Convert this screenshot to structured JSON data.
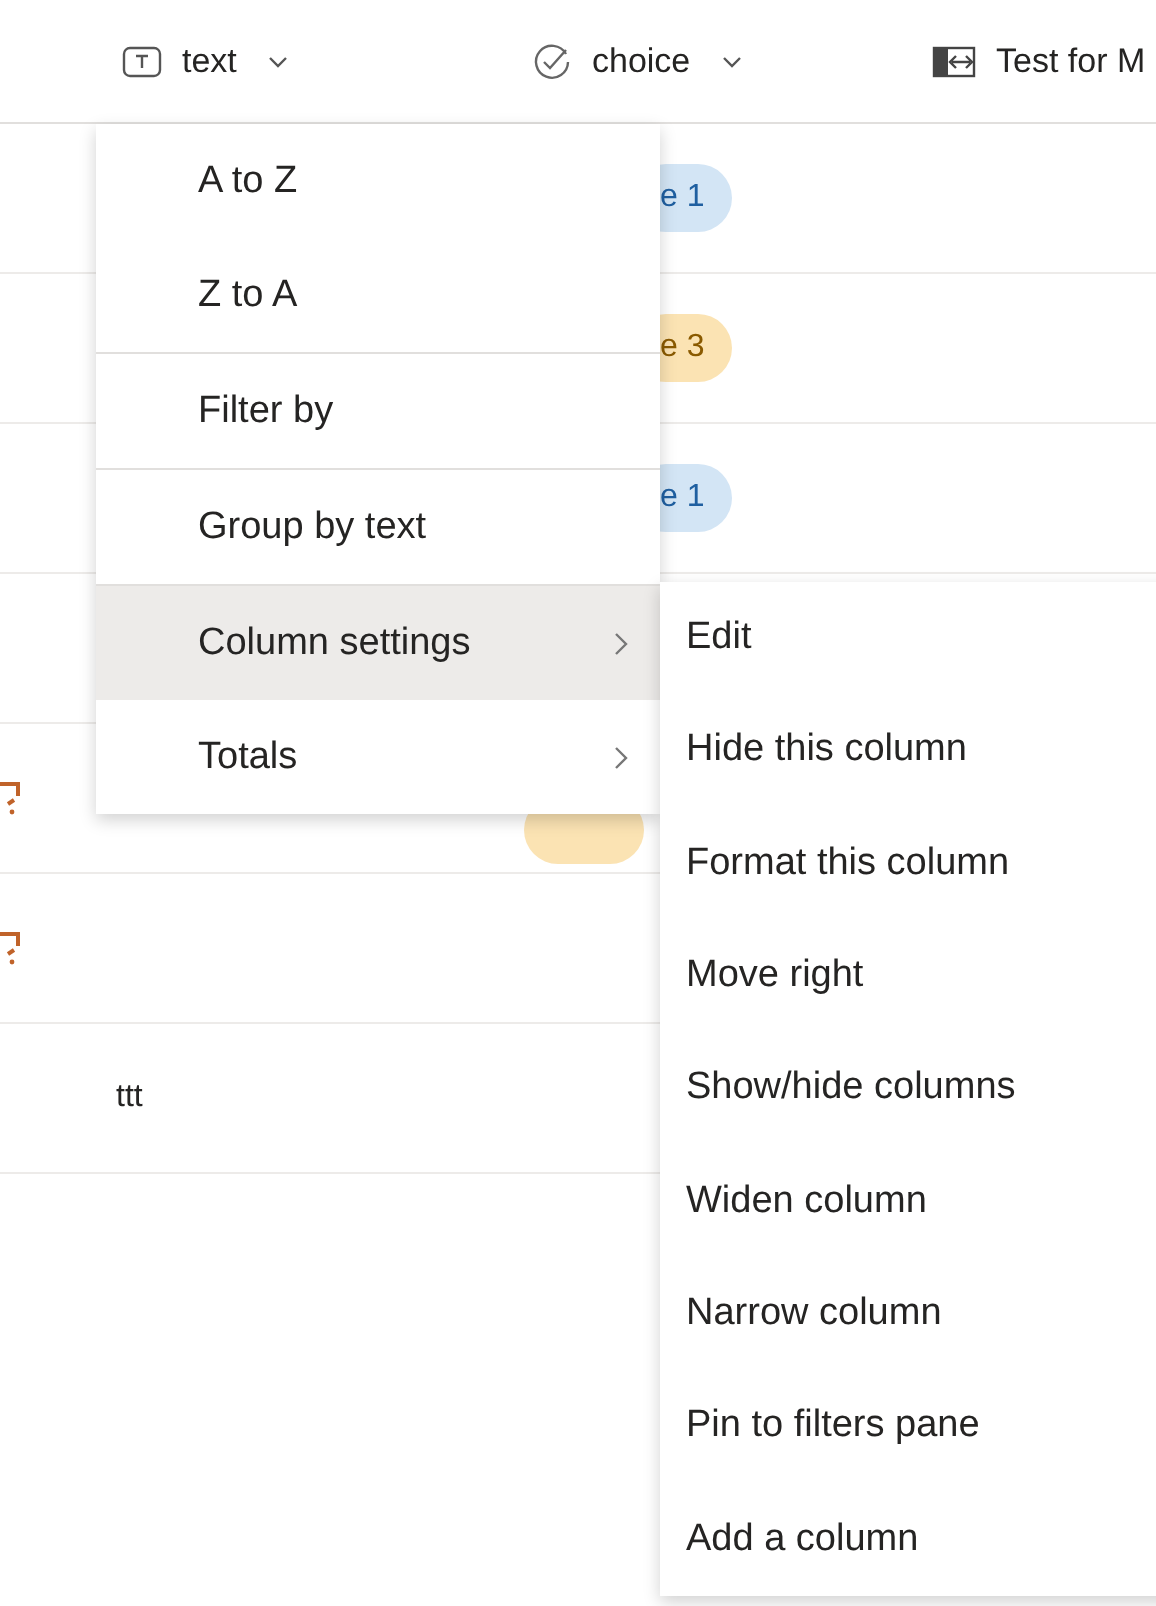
{
  "columns": [
    {
      "label": "text",
      "kind": "text",
      "caret": true
    },
    {
      "label": "choice",
      "kind": "choice",
      "caret": true
    },
    {
      "label": "Test for M",
      "kind": "lookup",
      "caret": false
    }
  ],
  "rows": [
    {
      "icon": false,
      "choice": {
        "label": "e 1",
        "color": "#d3e5f5"
      }
    },
    {
      "icon": false,
      "choice": {
        "label": "e 3",
        "color": "#fbe3b3"
      }
    },
    {
      "icon": false,
      "choice": {
        "label": "e 1",
        "color": "#d3e5f5"
      }
    },
    {
      "icon": false
    },
    {
      "icon": true,
      "choice": {
        "color": "#fbe3b3"
      }
    },
    {
      "icon": true
    },
    {
      "icon": false,
      "text": "ttt"
    }
  ],
  "menu": {
    "groups": [
      [
        {
          "label": "A to Z",
          "selected": false,
          "submenu": false
        },
        {
          "label": "Z to A",
          "selected": false,
          "submenu": false
        }
      ],
      [
        {
          "label": "Filter by",
          "selected": false,
          "submenu": false
        }
      ],
      [
        {
          "label": "Group by text",
          "selected": false,
          "submenu": false
        }
      ],
      [
        {
          "label": "Column settings",
          "selected": true,
          "submenu": true
        },
        {
          "label": "Totals",
          "selected": false,
          "submenu": true
        }
      ]
    ]
  },
  "submenu": {
    "items": [
      "Edit",
      "Hide this column",
      "Format this column",
      "Move right",
      "Show/hide columns",
      "Widen column",
      "Narrow column",
      "Pin to filters pane",
      "Add a column"
    ]
  }
}
